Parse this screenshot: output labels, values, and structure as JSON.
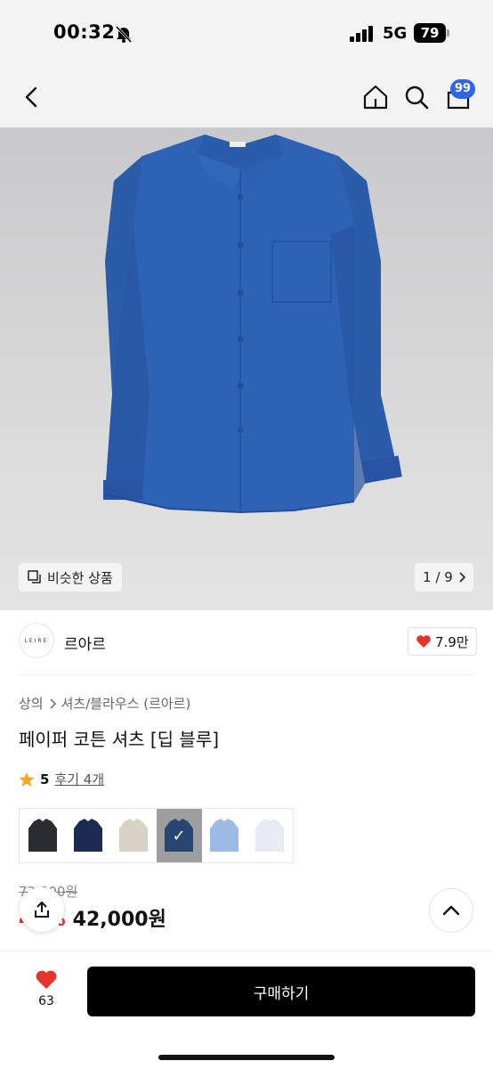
{
  "status_bar": {
    "time": "00:32",
    "network": "5G",
    "battery": "79"
  },
  "nav": {
    "cart_badge": "99"
  },
  "gallery": {
    "similar_label": "비슷한 상품",
    "page": "1 / 9"
  },
  "brand": {
    "logo_text": "LEIRE",
    "name": "르아르",
    "likes": "7.9만"
  },
  "product": {
    "breadcrumb": [
      "상의",
      "셔츠/블라우스 (르아르)"
    ],
    "title": "페이퍼 코튼 셔츠 [딥 블루]",
    "rating": "5",
    "reviews": "후기 4개",
    "original_price": "72,000원",
    "discount": "41%",
    "sale_price": "42,000원"
  },
  "swatches": [
    {
      "color": "#2b2c2f",
      "selected": false
    },
    {
      "color": "#1d2a52",
      "selected": false
    },
    {
      "color": "#d8d2c4",
      "selected": false
    },
    {
      "color": "#2a5fb0",
      "selected": true
    },
    {
      "color": "#9dbbe6",
      "selected": false
    },
    {
      "color": "#e7ebf2",
      "selected": false
    }
  ],
  "bottom_bar": {
    "wish_count": "63",
    "buy_label": "구매하기"
  },
  "colors": {
    "accent_red": "#e4342c",
    "badge_blue": "#2d67e6",
    "shirt_blue": "#2e62b4"
  }
}
